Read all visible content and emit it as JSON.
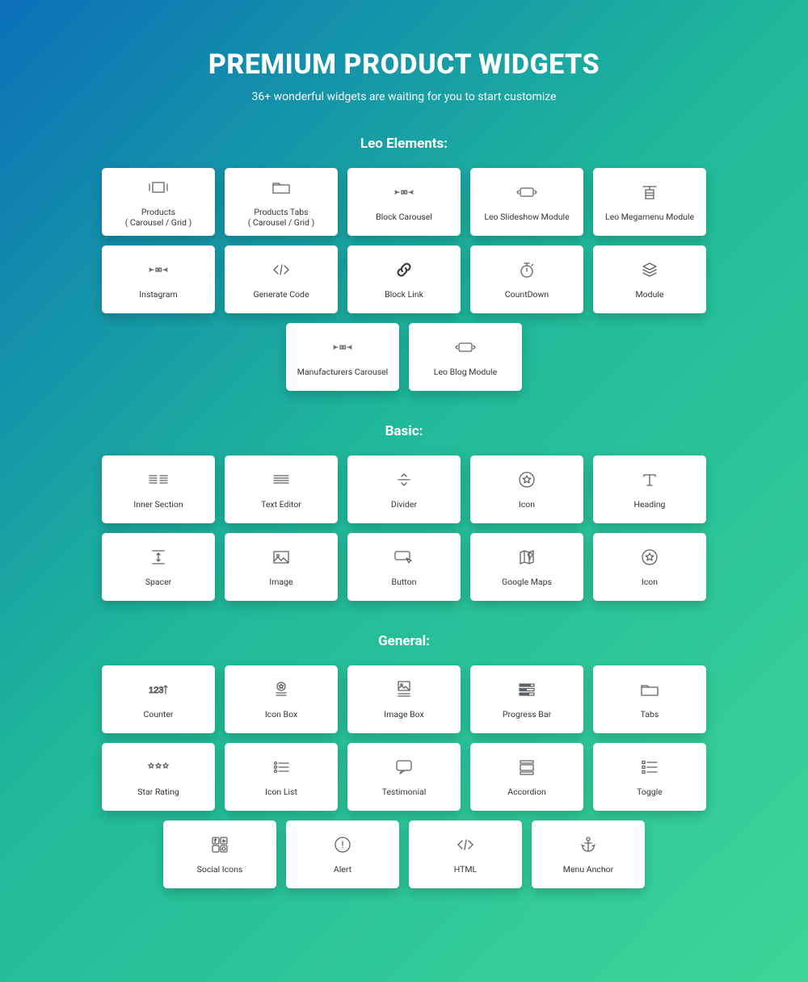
{
  "header": {
    "title": "PREMIUM PRODUCT WIDGETS",
    "subtitle": "36+ wonderful widgets are waiting for you to start customize"
  },
  "sections": {
    "leo": {
      "label": "Leo Elements:",
      "items": [
        {
          "label": "Products\n( Carousel / Grid )",
          "icon": "carousel"
        },
        {
          "label": "Products Tabs\n( Carousel / Grid )",
          "icon": "folder"
        },
        {
          "label": "Block Carousel",
          "icon": "arrows-small"
        },
        {
          "label": "Leo Slideshow Module",
          "icon": "slideshow"
        },
        {
          "label": "Leo Megamenu Module",
          "icon": "megamenu"
        },
        {
          "label": "Instagram",
          "icon": "arrows-small"
        },
        {
          "label": "Generate Code",
          "icon": "code"
        },
        {
          "label": "Block Link",
          "icon": "link"
        },
        {
          "label": "CountDown",
          "icon": "stopwatch"
        },
        {
          "label": "Module",
          "icon": "layers"
        },
        {
          "label": "Manufacturers Carousel",
          "icon": "arrows-small"
        },
        {
          "label": "Leo Blog Module",
          "icon": "slideshow"
        }
      ]
    },
    "basic": {
      "label": "Basic:",
      "items": [
        {
          "label": "Inner Section",
          "icon": "columns"
        },
        {
          "label": "Text Editor",
          "icon": "lines"
        },
        {
          "label": "Divider",
          "icon": "divider"
        },
        {
          "label": "Icon",
          "icon": "star-circle"
        },
        {
          "label": "Heading",
          "icon": "heading-t"
        },
        {
          "label": "Spacer",
          "icon": "spacer"
        },
        {
          "label": "Image",
          "icon": "image"
        },
        {
          "label": "Button",
          "icon": "button"
        },
        {
          "label": "Google Maps",
          "icon": "map"
        },
        {
          "label": "Icon",
          "icon": "star-circle"
        }
      ]
    },
    "general": {
      "label": "General:",
      "items": [
        {
          "label": "Counter",
          "icon": "counter"
        },
        {
          "label": "Icon Box",
          "icon": "icon-box"
        },
        {
          "label": "Image Box",
          "icon": "image-box"
        },
        {
          "label": "Progress Bar",
          "icon": "progress"
        },
        {
          "label": "Tabs",
          "icon": "folder"
        },
        {
          "label": "Star Rating",
          "icon": "stars"
        },
        {
          "label": "Icon List",
          "icon": "icon-list"
        },
        {
          "label": "Testimonial",
          "icon": "testimonial"
        },
        {
          "label": "Accordion",
          "icon": "accordion"
        },
        {
          "label": "Toggle",
          "icon": "toggle"
        },
        {
          "label": "Social Icons",
          "icon": "social"
        },
        {
          "label": "Alert",
          "icon": "alert"
        },
        {
          "label": "HTML",
          "icon": "code"
        },
        {
          "label": "Menu Anchor",
          "icon": "anchor"
        }
      ]
    }
  }
}
